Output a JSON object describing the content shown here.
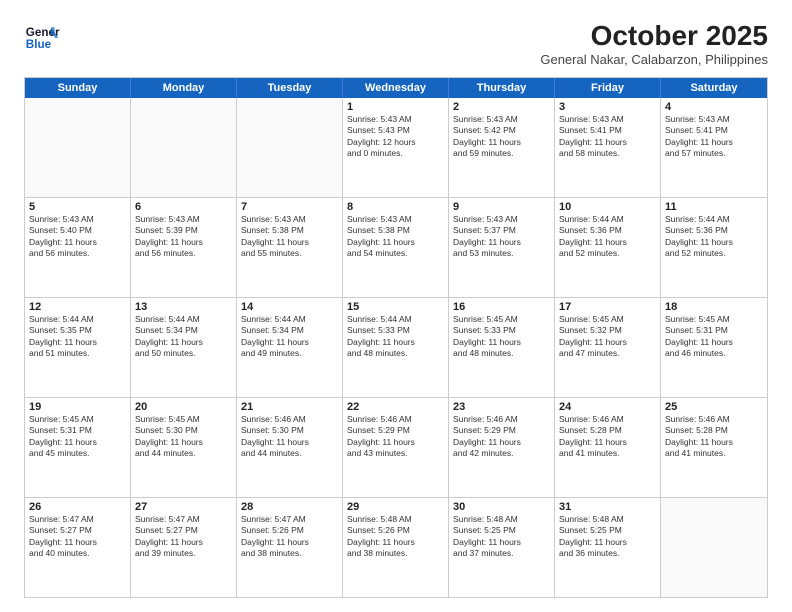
{
  "header": {
    "logo_line1": "General",
    "logo_line2": "Blue",
    "month": "October 2025",
    "location": "General Nakar, Calabarzon, Philippines"
  },
  "days_of_week": [
    "Sunday",
    "Monday",
    "Tuesday",
    "Wednesday",
    "Thursday",
    "Friday",
    "Saturday"
  ],
  "weeks": [
    [
      {
        "day": "",
        "text": ""
      },
      {
        "day": "",
        "text": ""
      },
      {
        "day": "",
        "text": ""
      },
      {
        "day": "1",
        "text": "Sunrise: 5:43 AM\nSunset: 5:43 PM\nDaylight: 12 hours\nand 0 minutes."
      },
      {
        "day": "2",
        "text": "Sunrise: 5:43 AM\nSunset: 5:42 PM\nDaylight: 11 hours\nand 59 minutes."
      },
      {
        "day": "3",
        "text": "Sunrise: 5:43 AM\nSunset: 5:41 PM\nDaylight: 11 hours\nand 58 minutes."
      },
      {
        "day": "4",
        "text": "Sunrise: 5:43 AM\nSunset: 5:41 PM\nDaylight: 11 hours\nand 57 minutes."
      }
    ],
    [
      {
        "day": "5",
        "text": "Sunrise: 5:43 AM\nSunset: 5:40 PM\nDaylight: 11 hours\nand 56 minutes."
      },
      {
        "day": "6",
        "text": "Sunrise: 5:43 AM\nSunset: 5:39 PM\nDaylight: 11 hours\nand 56 minutes."
      },
      {
        "day": "7",
        "text": "Sunrise: 5:43 AM\nSunset: 5:38 PM\nDaylight: 11 hours\nand 55 minutes."
      },
      {
        "day": "8",
        "text": "Sunrise: 5:43 AM\nSunset: 5:38 PM\nDaylight: 11 hours\nand 54 minutes."
      },
      {
        "day": "9",
        "text": "Sunrise: 5:43 AM\nSunset: 5:37 PM\nDaylight: 11 hours\nand 53 minutes."
      },
      {
        "day": "10",
        "text": "Sunrise: 5:44 AM\nSunset: 5:36 PM\nDaylight: 11 hours\nand 52 minutes."
      },
      {
        "day": "11",
        "text": "Sunrise: 5:44 AM\nSunset: 5:36 PM\nDaylight: 11 hours\nand 52 minutes."
      }
    ],
    [
      {
        "day": "12",
        "text": "Sunrise: 5:44 AM\nSunset: 5:35 PM\nDaylight: 11 hours\nand 51 minutes."
      },
      {
        "day": "13",
        "text": "Sunrise: 5:44 AM\nSunset: 5:34 PM\nDaylight: 11 hours\nand 50 minutes."
      },
      {
        "day": "14",
        "text": "Sunrise: 5:44 AM\nSunset: 5:34 PM\nDaylight: 11 hours\nand 49 minutes."
      },
      {
        "day": "15",
        "text": "Sunrise: 5:44 AM\nSunset: 5:33 PM\nDaylight: 11 hours\nand 48 minutes."
      },
      {
        "day": "16",
        "text": "Sunrise: 5:45 AM\nSunset: 5:33 PM\nDaylight: 11 hours\nand 48 minutes."
      },
      {
        "day": "17",
        "text": "Sunrise: 5:45 AM\nSunset: 5:32 PM\nDaylight: 11 hours\nand 47 minutes."
      },
      {
        "day": "18",
        "text": "Sunrise: 5:45 AM\nSunset: 5:31 PM\nDaylight: 11 hours\nand 46 minutes."
      }
    ],
    [
      {
        "day": "19",
        "text": "Sunrise: 5:45 AM\nSunset: 5:31 PM\nDaylight: 11 hours\nand 45 minutes."
      },
      {
        "day": "20",
        "text": "Sunrise: 5:45 AM\nSunset: 5:30 PM\nDaylight: 11 hours\nand 44 minutes."
      },
      {
        "day": "21",
        "text": "Sunrise: 5:46 AM\nSunset: 5:30 PM\nDaylight: 11 hours\nand 44 minutes."
      },
      {
        "day": "22",
        "text": "Sunrise: 5:46 AM\nSunset: 5:29 PM\nDaylight: 11 hours\nand 43 minutes."
      },
      {
        "day": "23",
        "text": "Sunrise: 5:46 AM\nSunset: 5:29 PM\nDaylight: 11 hours\nand 42 minutes."
      },
      {
        "day": "24",
        "text": "Sunrise: 5:46 AM\nSunset: 5:28 PM\nDaylight: 11 hours\nand 41 minutes."
      },
      {
        "day": "25",
        "text": "Sunrise: 5:46 AM\nSunset: 5:28 PM\nDaylight: 11 hours\nand 41 minutes."
      }
    ],
    [
      {
        "day": "26",
        "text": "Sunrise: 5:47 AM\nSunset: 5:27 PM\nDaylight: 11 hours\nand 40 minutes."
      },
      {
        "day": "27",
        "text": "Sunrise: 5:47 AM\nSunset: 5:27 PM\nDaylight: 11 hours\nand 39 minutes."
      },
      {
        "day": "28",
        "text": "Sunrise: 5:47 AM\nSunset: 5:26 PM\nDaylight: 11 hours\nand 38 minutes."
      },
      {
        "day": "29",
        "text": "Sunrise: 5:48 AM\nSunset: 5:26 PM\nDaylight: 11 hours\nand 38 minutes."
      },
      {
        "day": "30",
        "text": "Sunrise: 5:48 AM\nSunset: 5:25 PM\nDaylight: 11 hours\nand 37 minutes."
      },
      {
        "day": "31",
        "text": "Sunrise: 5:48 AM\nSunset: 5:25 PM\nDaylight: 11 hours\nand 36 minutes."
      },
      {
        "day": "",
        "text": ""
      }
    ]
  ]
}
